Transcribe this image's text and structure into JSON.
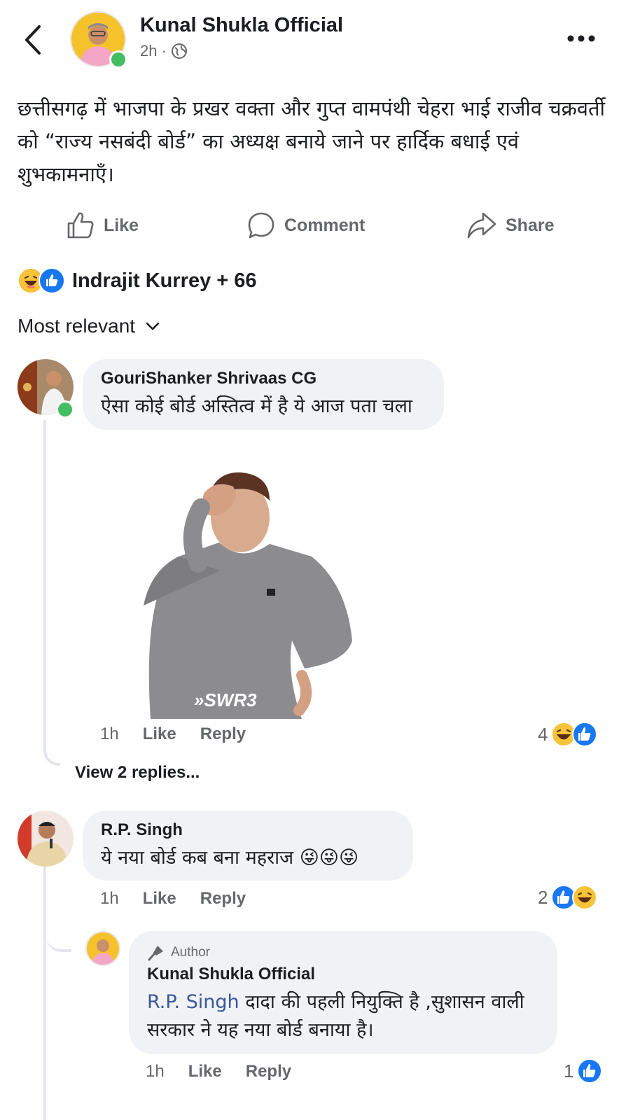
{
  "header": {
    "page_name": "Kunal Shukla Official",
    "time": "2h",
    "separator": "·"
  },
  "post": {
    "text": "छत्तीसगढ़ में भाजपा के प्रखर वक्ता और गुप्त वामपंथी चेहरा भाई राजीव चक्रवर्ती को “राज्य नसबंदी बोर्ड” का अध्यक्ष बनाये जाने पर हार्दिक बधाई एवं शुभकामनाएँ।"
  },
  "actions": {
    "like": "Like",
    "comment": "Comment",
    "share": "Share"
  },
  "reactions": {
    "summary": "Indrajit Kurrey + 66"
  },
  "sort": {
    "label": "Most relevant"
  },
  "comments": [
    {
      "author": "GouriShanker Shrivaas CG",
      "text": "ऐसा कोई बोर्ड अस्तित्व में है ये आज पता चला",
      "gif_caption": "»SWR3",
      "time": "1h",
      "like": "Like",
      "reply": "Reply",
      "reaction_count": "4",
      "view_replies": "View 2 replies..."
    },
    {
      "author": "R.P. Singh",
      "text": "ये नया बोर्ड कब बना महराज 😜😜😜",
      "time": "1h",
      "like": "Like",
      "reply": "Reply",
      "reaction_count": "2"
    }
  ],
  "reply": {
    "badge": "Author",
    "author": "Kunal Shukla Official",
    "mention": "R.P. Singh",
    "text": " दादा की पहली नियुक्ति है ,सुशासन वाली सरकार ने यह नया बोर्ड बनाया है।",
    "time": "1h",
    "like": "Like",
    "reply": "Reply",
    "reaction_count": "1"
  },
  "colors": {
    "like_blue": "#1877f2",
    "online_green": "#45bd62",
    "mention_blue": "#385898",
    "bubble_gray": "#f0f2f5"
  }
}
